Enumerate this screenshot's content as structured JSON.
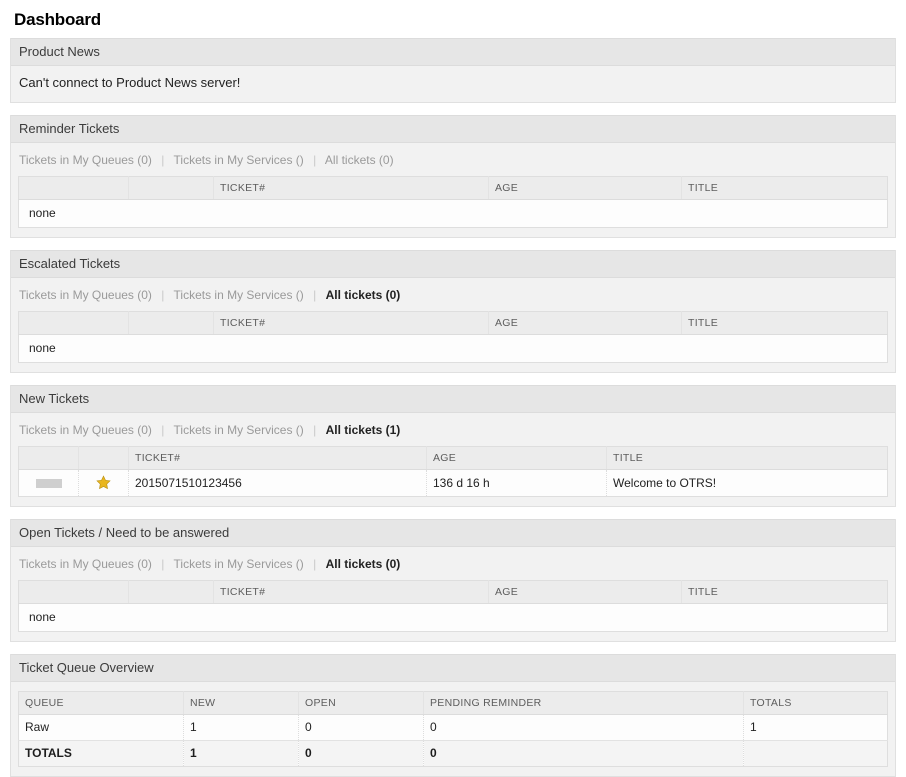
{
  "page": {
    "title": "Dashboard",
    "link_color": "#4e6e8e",
    "header_bg": "#e6e6e6",
    "widget_bg": "#f2f2f2",
    "star_color": "#e9b61e",
    "priority_color": "#cfcfcf"
  },
  "filter_labels": {
    "my_queues": "Tickets in My Queues (0)",
    "my_services": "Tickets in My Services ()",
    "separator": "|"
  },
  "widgets": {
    "product_news": {
      "title": "Product News",
      "message": "Can't connect to Product News server!"
    },
    "reminder_tickets": {
      "title": "Reminder Tickets",
      "filters": [
        {
          "label": "Tickets in My Queues (0)",
          "active": false
        },
        {
          "label": "Tickets in My Services ()",
          "active": false
        },
        {
          "label": "All tickets (0)",
          "active": false
        }
      ],
      "columns": [
        "",
        "",
        "TICKET#",
        "AGE",
        "TITLE"
      ],
      "empty_text": "none"
    },
    "escalated_tickets": {
      "title": "Escalated Tickets",
      "filters": [
        {
          "label": "Tickets in My Queues (0)",
          "active": false
        },
        {
          "label": "Tickets in My Services ()",
          "active": false
        },
        {
          "label": "All tickets (0)",
          "active": true
        }
      ],
      "columns": [
        "",
        "",
        "TICKET#",
        "AGE",
        "TITLE"
      ],
      "empty_text": "none"
    },
    "new_tickets": {
      "title": "New Tickets",
      "filters": [
        {
          "label": "Tickets in My Queues (0)",
          "active": false
        },
        {
          "label": "Tickets in My Services ()",
          "active": false
        },
        {
          "label": "All tickets (1)",
          "active": true
        }
      ],
      "columns": [
        "",
        "",
        "TICKET#",
        "AGE",
        "TITLE"
      ],
      "rows": [
        {
          "priority": "priority-indicator",
          "flag": "star-icon",
          "ticket_number": "2015071510123456",
          "age": "136 d 16 h",
          "title": "Welcome to OTRS!"
        }
      ]
    },
    "open_tickets": {
      "title": "Open Tickets / Need to be answered",
      "filters": [
        {
          "label": "Tickets in My Queues (0)",
          "active": false
        },
        {
          "label": "Tickets in My Services ()",
          "active": false
        },
        {
          "label": "All tickets (0)",
          "active": true
        }
      ],
      "columns": [
        "",
        "",
        "TICKET#",
        "AGE",
        "TITLE"
      ],
      "empty_text": "none"
    },
    "queue_overview": {
      "title": "Ticket Queue Overview",
      "columns": [
        "QUEUE",
        "NEW",
        "OPEN",
        "PENDING REMINDER",
        "TOTALS"
      ],
      "rows": [
        {
          "queue": "Raw",
          "new": "1",
          "open": "0",
          "pending_reminder": "0",
          "totals": "1"
        }
      ],
      "totals_row": {
        "queue": "TOTALS",
        "new": "1",
        "open": "0",
        "pending_reminder": "0",
        "totals": ""
      }
    }
  }
}
